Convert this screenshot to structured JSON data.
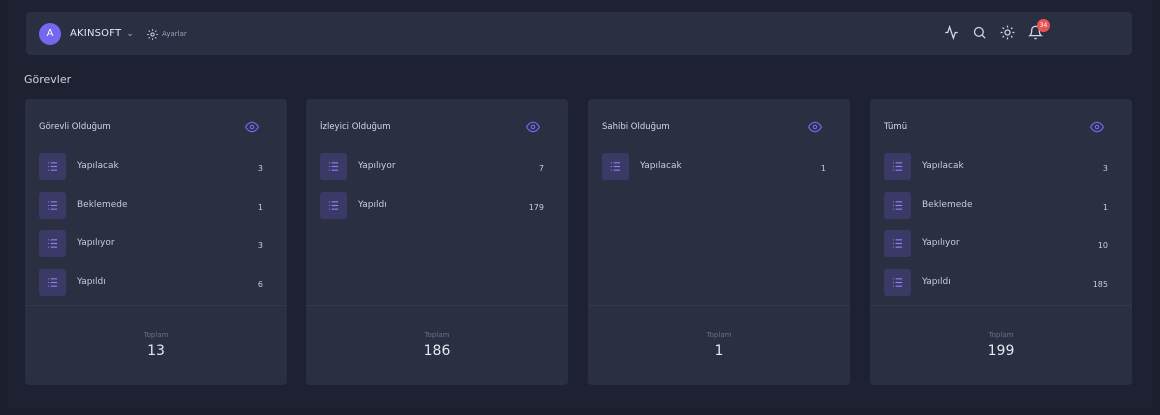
{
  "header": {
    "avatar_initial": "A",
    "company_name": "AKINSOFT",
    "settings_label": "Ayarlar",
    "notification_count": "34",
    "icons": [
      "activity-icon",
      "search-icon",
      "sun-icon",
      "bell-icon"
    ]
  },
  "page": {
    "title": "Görevler"
  },
  "colors": {
    "accent": "#7467f0",
    "badge": "#ea5455",
    "card": "#2a2f42",
    "background": "#1d2131"
  },
  "cards": [
    {
      "title": "Görevli Olduğum",
      "rows": [
        {
          "label": "Yapılacak",
          "count": "3"
        },
        {
          "label": "Beklemede",
          "count": "1"
        },
        {
          "label": "Yapılıyor",
          "count": "3"
        },
        {
          "label": "Yapıldı",
          "count": "6"
        }
      ],
      "footer_label": "Toplam",
      "footer_value": "13"
    },
    {
      "title": "İzleyici Olduğum",
      "rows": [
        {
          "label": "Yapılıyor",
          "count": "7"
        },
        {
          "label": "Yapıldı",
          "count": "179"
        }
      ],
      "footer_label": "Toplam",
      "footer_value": "186"
    },
    {
      "title": "Sahibi Olduğum",
      "rows": [
        {
          "label": "Yapılacak",
          "count": "1"
        }
      ],
      "footer_label": "Toplam",
      "footer_value": "1"
    },
    {
      "title": "Tümü",
      "rows": [
        {
          "label": "Yapılacak",
          "count": "3"
        },
        {
          "label": "Beklemede",
          "count": "1"
        },
        {
          "label": "Yapılıyor",
          "count": "10"
        },
        {
          "label": "Yapıldı",
          "count": "185"
        }
      ],
      "footer_label": "Toplam",
      "footer_value": "199"
    }
  ]
}
